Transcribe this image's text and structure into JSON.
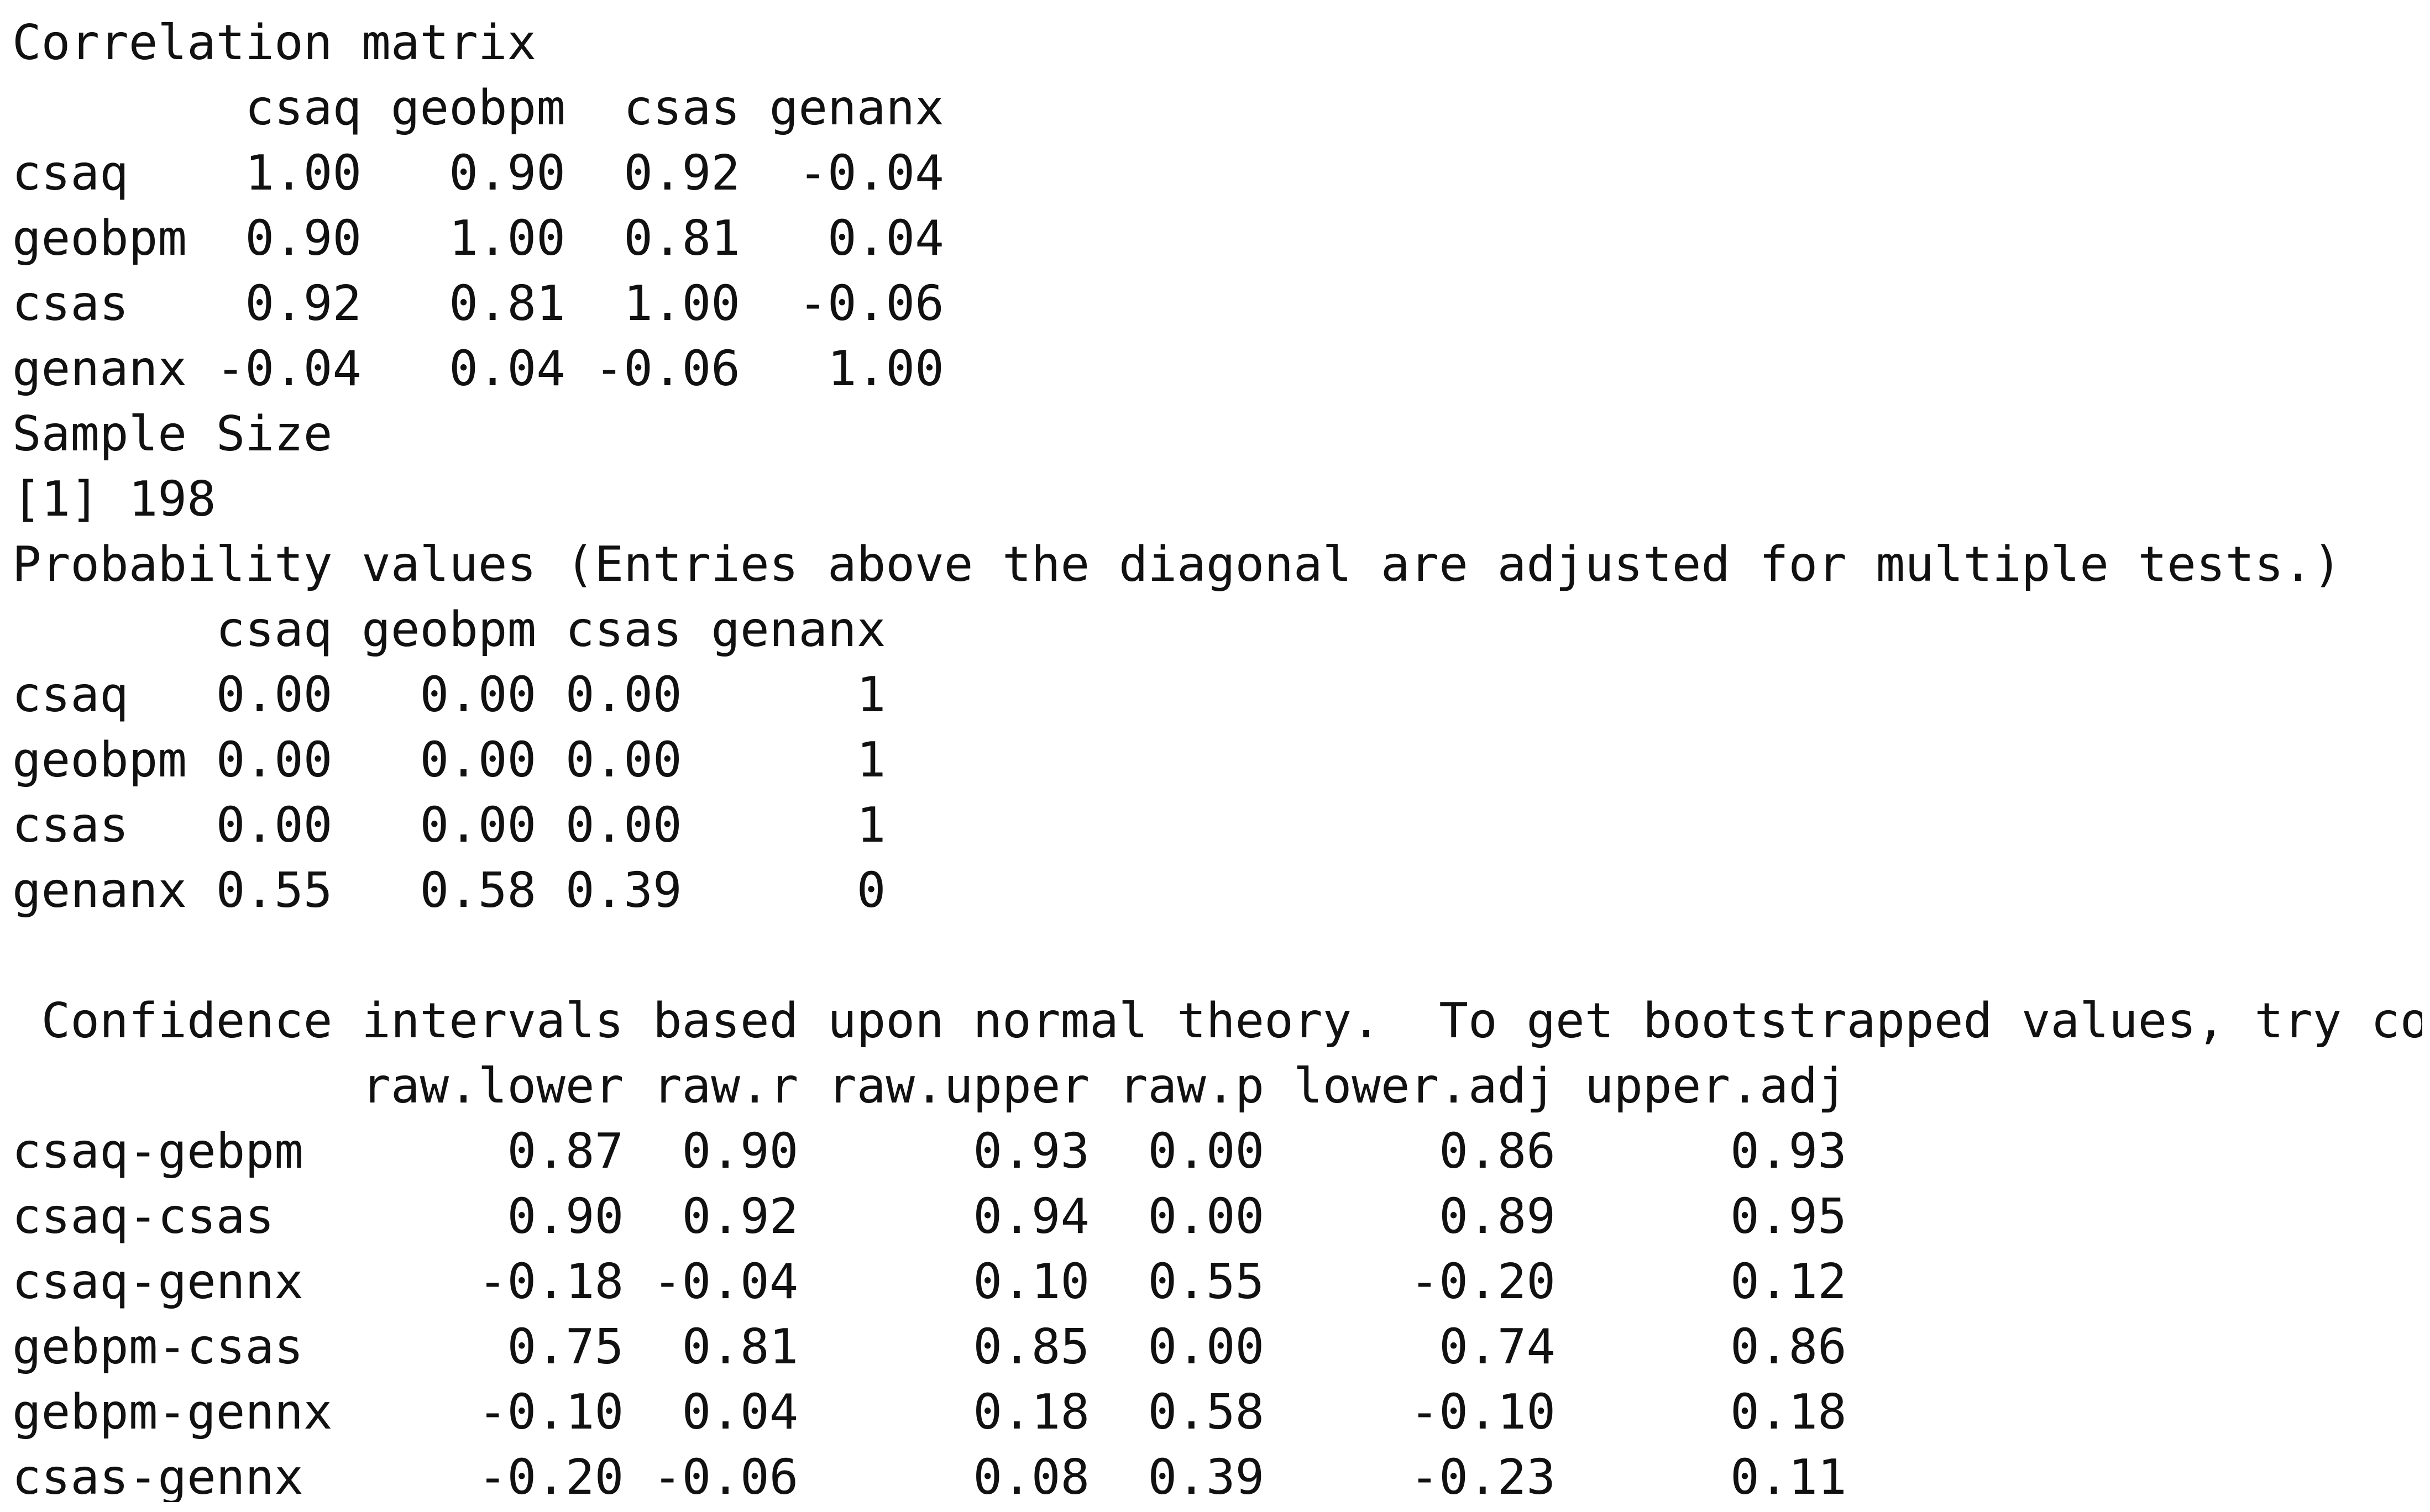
{
  "console_lines": [
    "Correlation matrix",
    "        csaq geobpm  csas genanx",
    "csaq    1.00   0.90  0.92  -0.04",
    "geobpm  0.90   1.00  0.81   0.04",
    "csas    0.92   0.81  1.00  -0.06",
    "genanx -0.04   0.04 -0.06   1.00",
    "Sample Size",
    "[1] 198",
    "Probability values (Entries above the diagonal are adjusted for multiple tests.)",
    "       csaq geobpm csas genanx",
    "csaq   0.00   0.00 0.00      1",
    "geobpm 0.00   0.00 0.00      1",
    "csas   0.00   0.00 0.00      1",
    "genanx 0.55   0.58 0.39      0",
    "",
    " Confidence intervals based upon normal theory.  To get bootstrapped values, try cor.ci",
    "            raw.lower raw.r raw.upper raw.p lower.adj upper.adj",
    "csaq-gebpm       0.87  0.90      0.93  0.00      0.86      0.93",
    "csaq-csas        0.90  0.92      0.94  0.00      0.89      0.95",
    "csaq-gennx      -0.18 -0.04      0.10  0.55     -0.20      0.12",
    "gebpm-csas       0.75  0.81      0.85  0.00      0.74      0.86",
    "gebpm-gennx     -0.10  0.04      0.18  0.58     -0.10      0.18",
    "csas-gennx      -0.20 -0.06      0.08  0.39     -0.23      0.11"
  ]
}
